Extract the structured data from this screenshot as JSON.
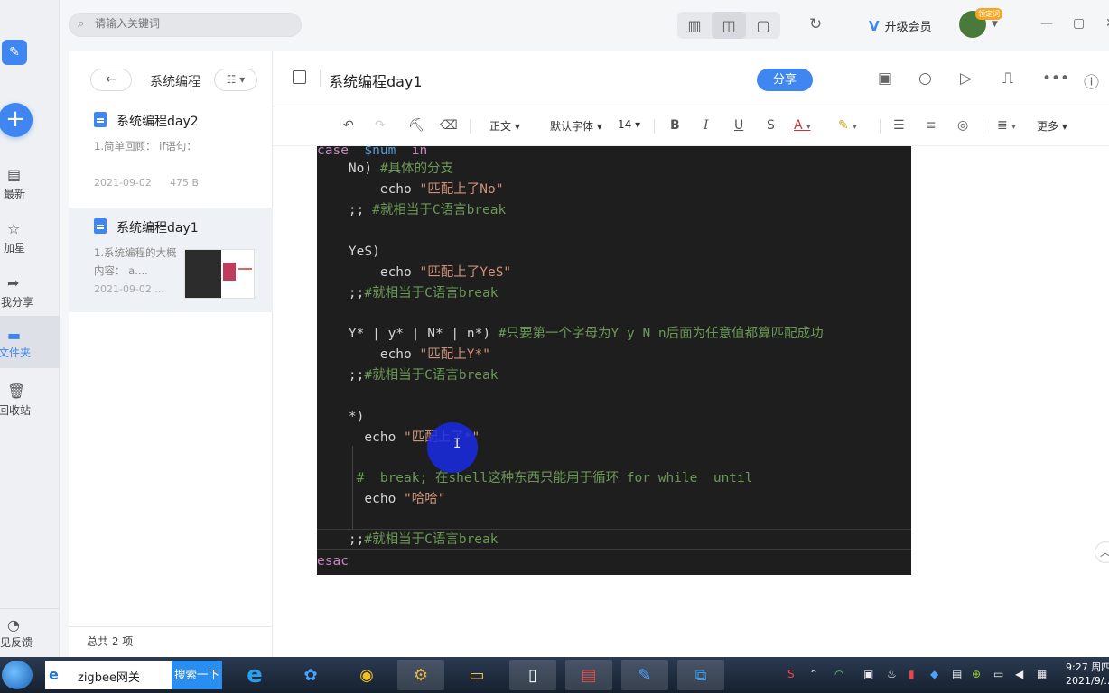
{
  "colors": {
    "accent": "#3f86f0",
    "code_bg": "#1e1e1e",
    "keyword": "#c586c0",
    "comment": "#6a9955",
    "string": "#ce9178",
    "variable": "#569cd6"
  },
  "search": {
    "placeholder": "请输入关键词"
  },
  "sidebar": {
    "items": [
      {
        "label": "最新",
        "icon": "recent-icon"
      },
      {
        "label": "加星",
        "icon": "star-icon"
      },
      {
        "label": "与我分享",
        "icon": "share-icon"
      },
      {
        "label": "文件夹",
        "icon": "folder-icon"
      },
      {
        "label": "回收站",
        "icon": "trash-icon"
      }
    ],
    "feedback": "意见反馈"
  },
  "topbar": {
    "vip_label": "升级会员",
    "avatar_badge": "领定词"
  },
  "list": {
    "folder_title": "系统编程",
    "notes": [
      {
        "title": "系统编程day2",
        "snippet": "1.简单回顾： if语句：",
        "date": "2021-09-02",
        "size": "475 B"
      },
      {
        "title": "系统编程day1",
        "snippet": "1.系统编程的大概内容： a....",
        "date": "2021-09-02 ..."
      }
    ],
    "footer": "总共 2 项"
  },
  "editor": {
    "title": "系统编程day1",
    "share_label": "分享",
    "format": {
      "paragraph": "正文",
      "font": "默认字体",
      "size": "14",
      "more": "更多"
    }
  },
  "code": {
    "l0": "case  $num  in",
    "l1a": "    No) ",
    "l1b": "#具体的分支",
    "l2a": "        echo ",
    "l2b": "\"匹配上了No\"",
    "l3a": "    ;; ",
    "l3b": "#就相当于C语言break",
    "l5": "    YeS)",
    "l6a": "        echo ",
    "l6b": "\"匹配上了YeS\"",
    "l7a": "    ;;",
    "l7b": "#就相当于C语言break",
    "l9a": "    Y* | y* | N* | n*) ",
    "l9b": "#只要第一个字母为Y y N n后面为任意值都算匹配成功",
    "l10a": "        echo ",
    "l10b": "\"匹配上Y*\"",
    "l11a": "    ;;",
    "l11b": "#就相当于C语言break",
    "l13": "    *)",
    "l14a": "      echo ",
    "l14b": "\"匹配上了*\"",
    "l16": "     #  break; 在shell这种东西只能用于循环 for while  until",
    "l17a": "      echo ",
    "l17b": "\"哈哈\"",
    "l19a": "    ;;",
    "l19b": "#就相当于C语言break",
    "l20": "esac"
  },
  "taskbar": {
    "search_text": "zigbee网关",
    "search_button": "搜索一下",
    "time": "9:27 周四",
    "date": "2021/9/..."
  }
}
